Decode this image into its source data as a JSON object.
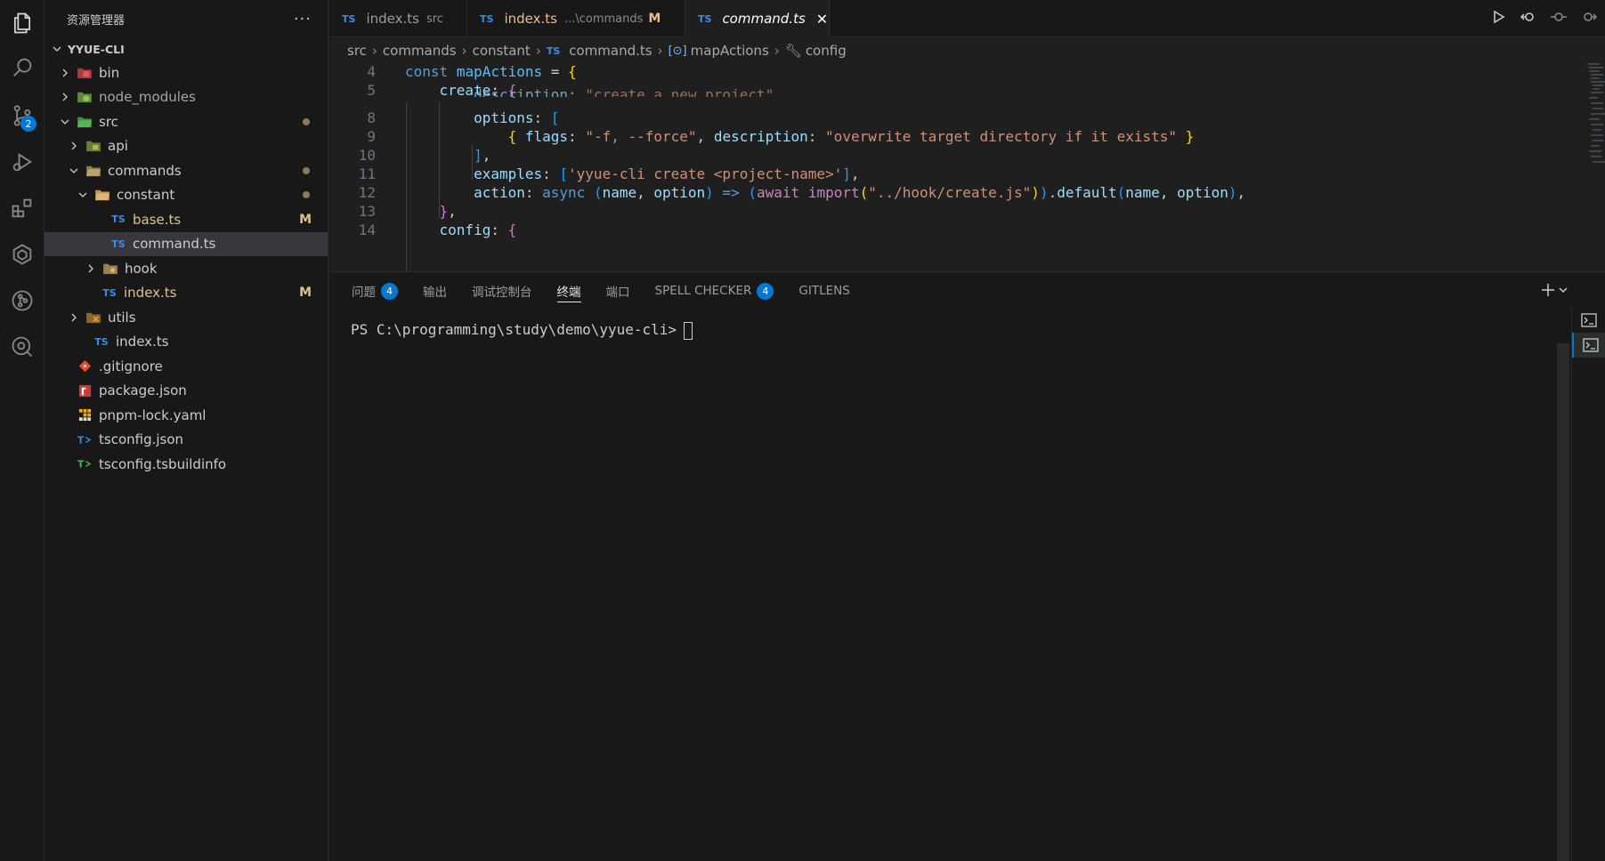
{
  "sidebar": {
    "title": "资源管理器",
    "more": "···",
    "root": "YYUE-CLI",
    "items": [
      {
        "label": "bin",
        "mark": ""
      },
      {
        "label": "node_modules",
        "mark": ""
      },
      {
        "label": "src",
        "mark": "dot"
      },
      {
        "label": "api",
        "mark": ""
      },
      {
        "label": "commands",
        "mark": "dot"
      },
      {
        "label": "constant",
        "mark": "dot"
      },
      {
        "label": "base.ts",
        "mark": "M"
      },
      {
        "label": "command.ts",
        "mark": ""
      },
      {
        "label": "hook",
        "mark": ""
      },
      {
        "label": "index.ts",
        "mark": "M"
      },
      {
        "label": "utils",
        "mark": ""
      },
      {
        "label": "index.ts",
        "mark": ""
      },
      {
        "label": ".gitignore",
        "mark": ""
      },
      {
        "label": "package.json",
        "mark": ""
      },
      {
        "label": "pnpm-lock.yaml",
        "mark": ""
      },
      {
        "label": "tsconfig.json",
        "mark": ""
      },
      {
        "label": "tsconfig.tsbuildinfo",
        "mark": ""
      }
    ],
    "ts_label": "TS"
  },
  "tabs": [
    {
      "label": "index.ts",
      "desc": "src",
      "modified": ""
    },
    {
      "label": "index.ts",
      "desc": "...\\commands",
      "modified": "M"
    },
    {
      "label": "command.ts",
      "desc": "",
      "modified": ""
    }
  ],
  "breadcrumb": [
    "src",
    "commands",
    "constant",
    "command.ts",
    "mapActions",
    "config"
  ],
  "editor": {
    "line_numbers": [
      "4",
      "5",
      "8",
      "9",
      "10",
      "11",
      "12",
      "13",
      "14"
    ]
  },
  "panel": {
    "tabs": [
      {
        "label": "问题",
        "badge": "4"
      },
      {
        "label": "输出",
        "badge": ""
      },
      {
        "label": "调试控制台",
        "badge": ""
      },
      {
        "label": "终端",
        "badge": ""
      },
      {
        "label": "端口",
        "badge": ""
      },
      {
        "label": "SPELL CHECKER",
        "badge": "4"
      },
      {
        "label": "GITLENS",
        "badge": ""
      }
    ],
    "terminal_prompt": "PS C:\\programming\\study\\demo\\yyue-cli>"
  },
  "activity": {
    "scm_badge": "2"
  },
  "colors": {
    "accent": "#0078d4",
    "ts": "#3c8ce7",
    "modified": "#e2c08d"
  }
}
